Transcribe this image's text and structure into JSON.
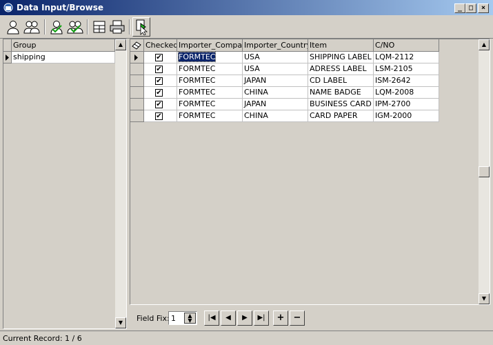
{
  "window": {
    "title": "Data Input/Browse"
  },
  "toolbar": {
    "buttons": [
      "user-icon",
      "users-icon",
      "user-check-icon",
      "users-check-icon",
      "layout-icon",
      "print-icon",
      "export-icon"
    ]
  },
  "group_pane": {
    "header": "Group",
    "items": [
      "shipping"
    ]
  },
  "grid": {
    "columns": [
      "Checked",
      "Importer_Company",
      "Importer_Country",
      "Item",
      "C/NO"
    ],
    "rows": [
      {
        "checked": "✔",
        "company": "FORMTEC",
        "country": "USA",
        "item": "SHIPPING LABEL",
        "cno": "LQM-2112"
      },
      {
        "checked": "✔",
        "company": "FORMTEC",
        "country": "USA",
        "item": "ADRESS LABEL",
        "cno": "LSM-2105"
      },
      {
        "checked": "✔",
        "company": "FORMTEC",
        "country": "JAPAN",
        "item": "CD LABEL",
        "cno": "ISM-2642"
      },
      {
        "checked": "✔",
        "company": "FORMTEC",
        "country": "CHINA",
        "item": "NAME BADGE",
        "cno": "LQM-2008"
      },
      {
        "checked": "✔",
        "company": "FORMTEC",
        "country": "JAPAN",
        "item": "BUSINESS CARD",
        "cno": "IPM-2700"
      },
      {
        "checked": "✔",
        "company": "FORMTEC",
        "country": "CHINA",
        "item": "CARD PAPER",
        "cno": "IGM-2000"
      }
    ],
    "selected_row": 0
  },
  "navigator": {
    "field_fix_label": "Field Fix:",
    "field_fix_value": "1",
    "buttons": {
      "first": "|◀",
      "prev": "◀",
      "next": "▶",
      "last": "▶|",
      "add": "+",
      "remove": "−"
    }
  },
  "status": {
    "text": "Current Record: 1 / 6"
  }
}
